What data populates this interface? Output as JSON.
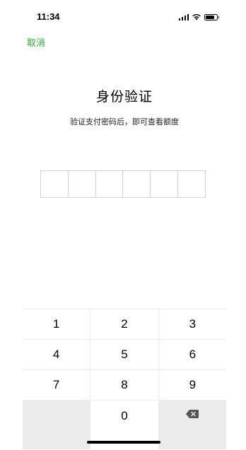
{
  "status_bar": {
    "time": "11:34"
  },
  "header": {
    "cancel_label": "取消"
  },
  "main": {
    "title": "身份验证",
    "subtitle": "验证支付密码后，即可查看额度",
    "pin_length": 6
  },
  "keypad": {
    "rows": [
      [
        "1",
        "2",
        "3"
      ],
      [
        "4",
        "5",
        "6"
      ],
      [
        "7",
        "8",
        "9"
      ]
    ],
    "zero": "0",
    "backspace_icon": "backspace-icon"
  },
  "colors": {
    "accent": "#2aab34",
    "keypad_gray": "#ebebeb"
  }
}
